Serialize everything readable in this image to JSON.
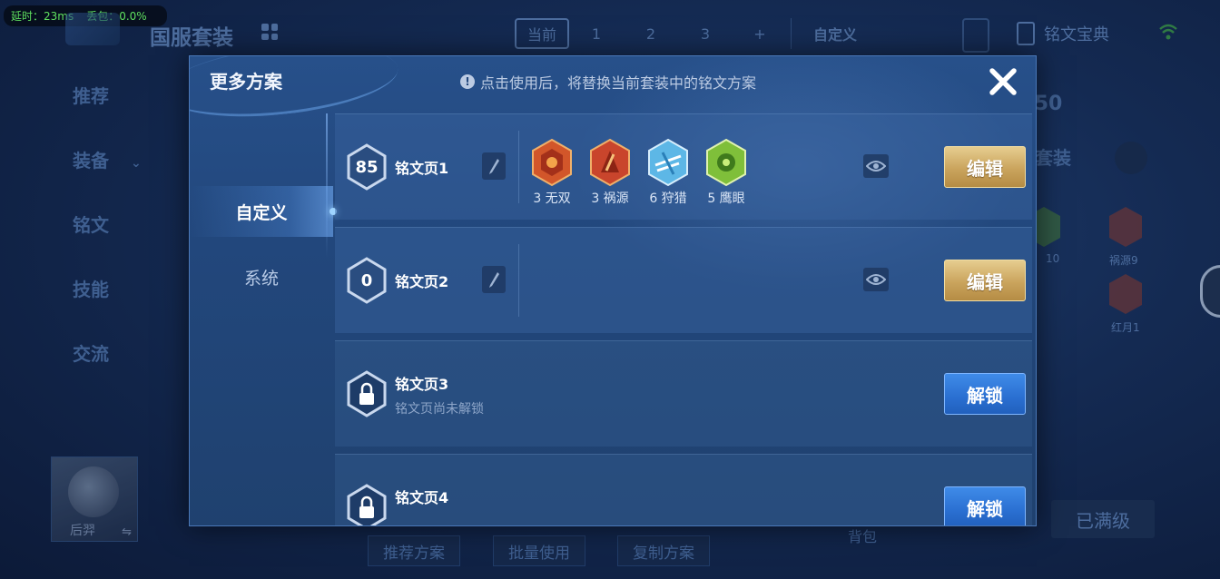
{
  "status": {
    "latency": "延时：23ms",
    "packet_loss": "丢包：0.0%"
  },
  "background": {
    "title": "国服套装",
    "tabs": [
      "当前",
      "1",
      "2",
      "3",
      "+",
      "自定义"
    ],
    "book_label": "铭文宝典",
    "sidebar": [
      "推荐",
      "装备",
      "铭文",
      "技能",
      "交流"
    ],
    "hero_name": "后羿",
    "bottom_buttons": [
      "推荐方案",
      "批量使用",
      "复制方案"
    ],
    "backpack_label": "背包",
    "maxed_label": "已满级",
    "level_badge": "50",
    "suite_label": "套装",
    "gem_labels": [
      "10",
      "祸源9",
      "红月1"
    ]
  },
  "modal": {
    "title": "更多方案",
    "notice": "点击使用后，将替换当前套装中的铭文方案",
    "close_icon": "close-icon",
    "tabs": [
      {
        "label": "自定义",
        "active": true
      },
      {
        "label": "系统",
        "active": false
      }
    ],
    "pages": [
      {
        "level": "85",
        "name": "铭文页1",
        "runes": [
          {
            "label": "3 无双",
            "color": "#d2562a"
          },
          {
            "label": "3 祸源",
            "color": "#c9452c"
          },
          {
            "label": "6 狩猎",
            "color": "#5db7e6"
          },
          {
            "label": "5 鹰眼",
            "color": "#7fbf3a"
          }
        ],
        "action": "编辑"
      },
      {
        "level": "0",
        "name": "铭文页2",
        "runes": [],
        "action": "编辑"
      },
      {
        "name": "铭文页3",
        "subtitle": "铭文页尚未解锁",
        "action": "解锁",
        "locked": true
      },
      {
        "name": "铭文页4",
        "action": "解锁",
        "locked": true
      }
    ]
  }
}
